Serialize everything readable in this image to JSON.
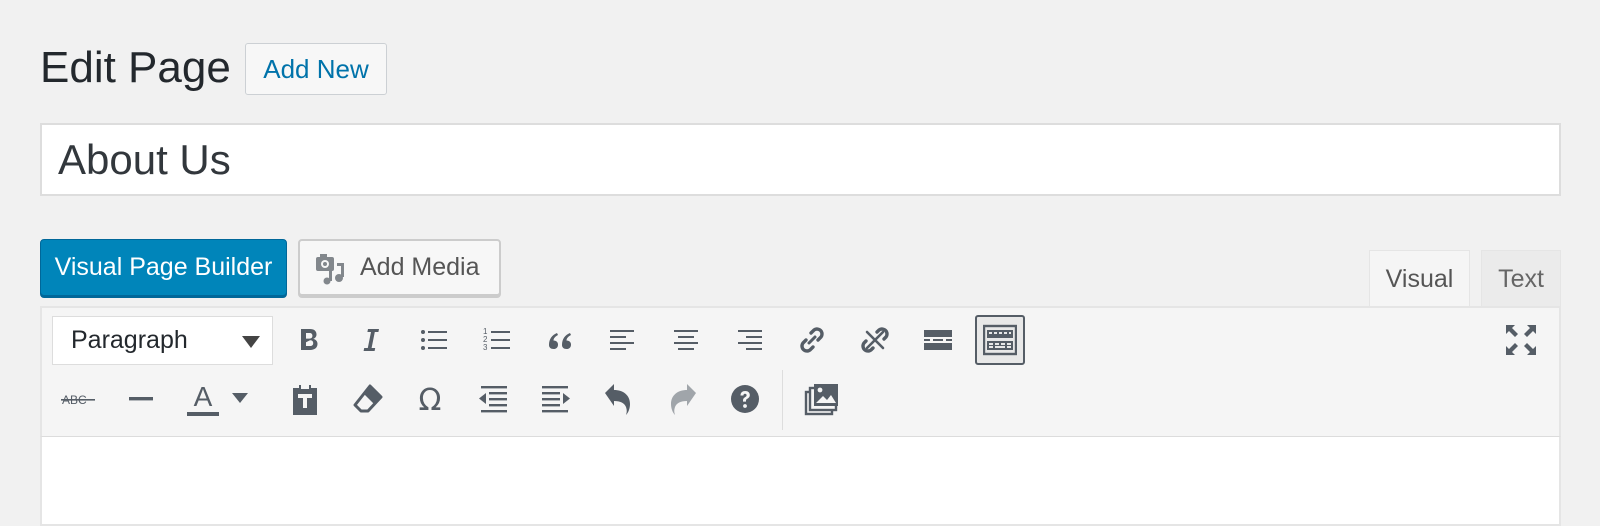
{
  "header": {
    "title": "Edit Page",
    "add_new_label": "Add New"
  },
  "post_title": {
    "value": "About Us"
  },
  "buttons": {
    "visual_page_builder": "Visual Page Builder",
    "add_media": "Add Media"
  },
  "tabs": [
    {
      "label": "Visual",
      "active": true
    },
    {
      "label": "Text",
      "active": false
    }
  ],
  "toolbar": {
    "format_select": "Paragraph",
    "text_color_letter": "A",
    "strike_text": "ABC",
    "row1_icons": [
      "bold-icon",
      "italic-icon",
      "bullet-list-icon",
      "numbered-list-icon",
      "blockquote-icon",
      "align-left-icon",
      "align-center-icon",
      "align-right-icon",
      "link-icon",
      "unlink-icon",
      "read-more-icon",
      "toolbar-toggle-icon",
      "fullscreen-icon"
    ],
    "row2_icons": [
      "strikethrough-icon",
      "horizontal-line-icon",
      "text-color-icon",
      "paste-as-text-icon",
      "clear-formatting-icon",
      "special-character-icon",
      "outdent-icon",
      "indent-icon",
      "undo-icon",
      "redo-icon",
      "help-icon",
      "gallery-icon"
    ]
  },
  "colors": {
    "primary": "#0085ba",
    "link": "#0073aa",
    "background": "#f1f1f1",
    "icon": "#555d66"
  }
}
